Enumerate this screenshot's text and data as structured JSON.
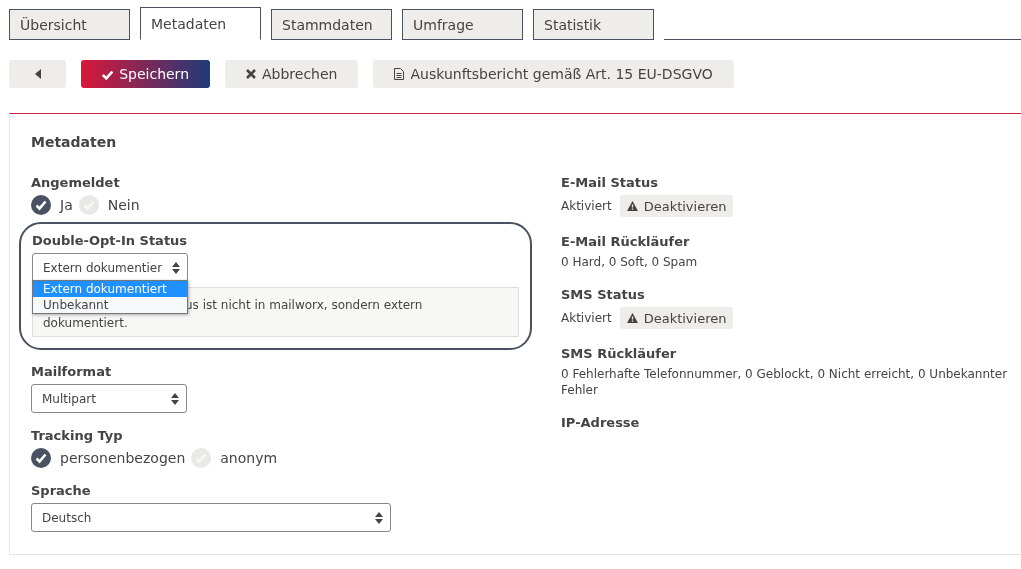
{
  "tabs": [
    {
      "label": "Übersicht",
      "selected": false
    },
    {
      "label": "Metadaten",
      "selected": true
    },
    {
      "label": "Stammdaten",
      "selected": false
    },
    {
      "label": "Umfrage",
      "selected": false
    },
    {
      "label": "Statistik",
      "selected": false
    }
  ],
  "toolbar": [
    {
      "kind": "back"
    },
    {
      "kind": "save",
      "label": "Speichern"
    },
    {
      "kind": "cancel",
      "label": "Abbrechen"
    },
    {
      "kind": "report",
      "label": "Auskunftsbericht gemäß Art. 15 EU-DSGVO"
    }
  ],
  "panel": {
    "title": "Metadaten",
    "left": [
      {
        "kind": "radio",
        "label": "Angemeldet",
        "options": [
          {
            "label": "Ja",
            "selected": true
          },
          {
            "label": "Nein",
            "selected": false
          }
        ]
      },
      {
        "kind": "select",
        "label": "Double-Opt-In Status",
        "value": "Extern dokumentier",
        "highlighted": true,
        "options": [
          {
            "label": "Extern dokumentiert",
            "selected": true
          },
          {
            "label": "Unbekannt",
            "selected": false
          }
        ],
        "info": "us ist nicht in mailworx, sondern extern dokumentiert."
      },
      {
        "kind": "select",
        "label": "Mailformat",
        "value": "Multipart"
      },
      {
        "kind": "radio",
        "label": "Tracking Typ",
        "options": [
          {
            "label": "personenbezogen",
            "selected": true
          },
          {
            "label": "anonym",
            "selected": false
          }
        ]
      },
      {
        "kind": "wide-select",
        "label": "Sprache",
        "value": "Deutsch"
      }
    ],
    "right": [
      {
        "kind": "status",
        "label": "E-Mail Status",
        "value": "Aktiviert",
        "action": "Deaktivieren"
      },
      {
        "kind": "text",
        "label": "E-Mail Rückläufer",
        "value": "0 Hard, 0 Soft, 0 Spam"
      },
      {
        "kind": "status",
        "label": "SMS Status",
        "value": "Aktiviert",
        "action": "Deaktivieren"
      },
      {
        "kind": "text",
        "label": "SMS Rückläufer",
        "value": "0 Fehlerhafte Telefonnummer, 0 Geblockt, 0 Nicht erreicht, 0 Unbekannter Fehler"
      },
      {
        "kind": "text",
        "label": "IP-Adresse"
      }
    ]
  }
}
